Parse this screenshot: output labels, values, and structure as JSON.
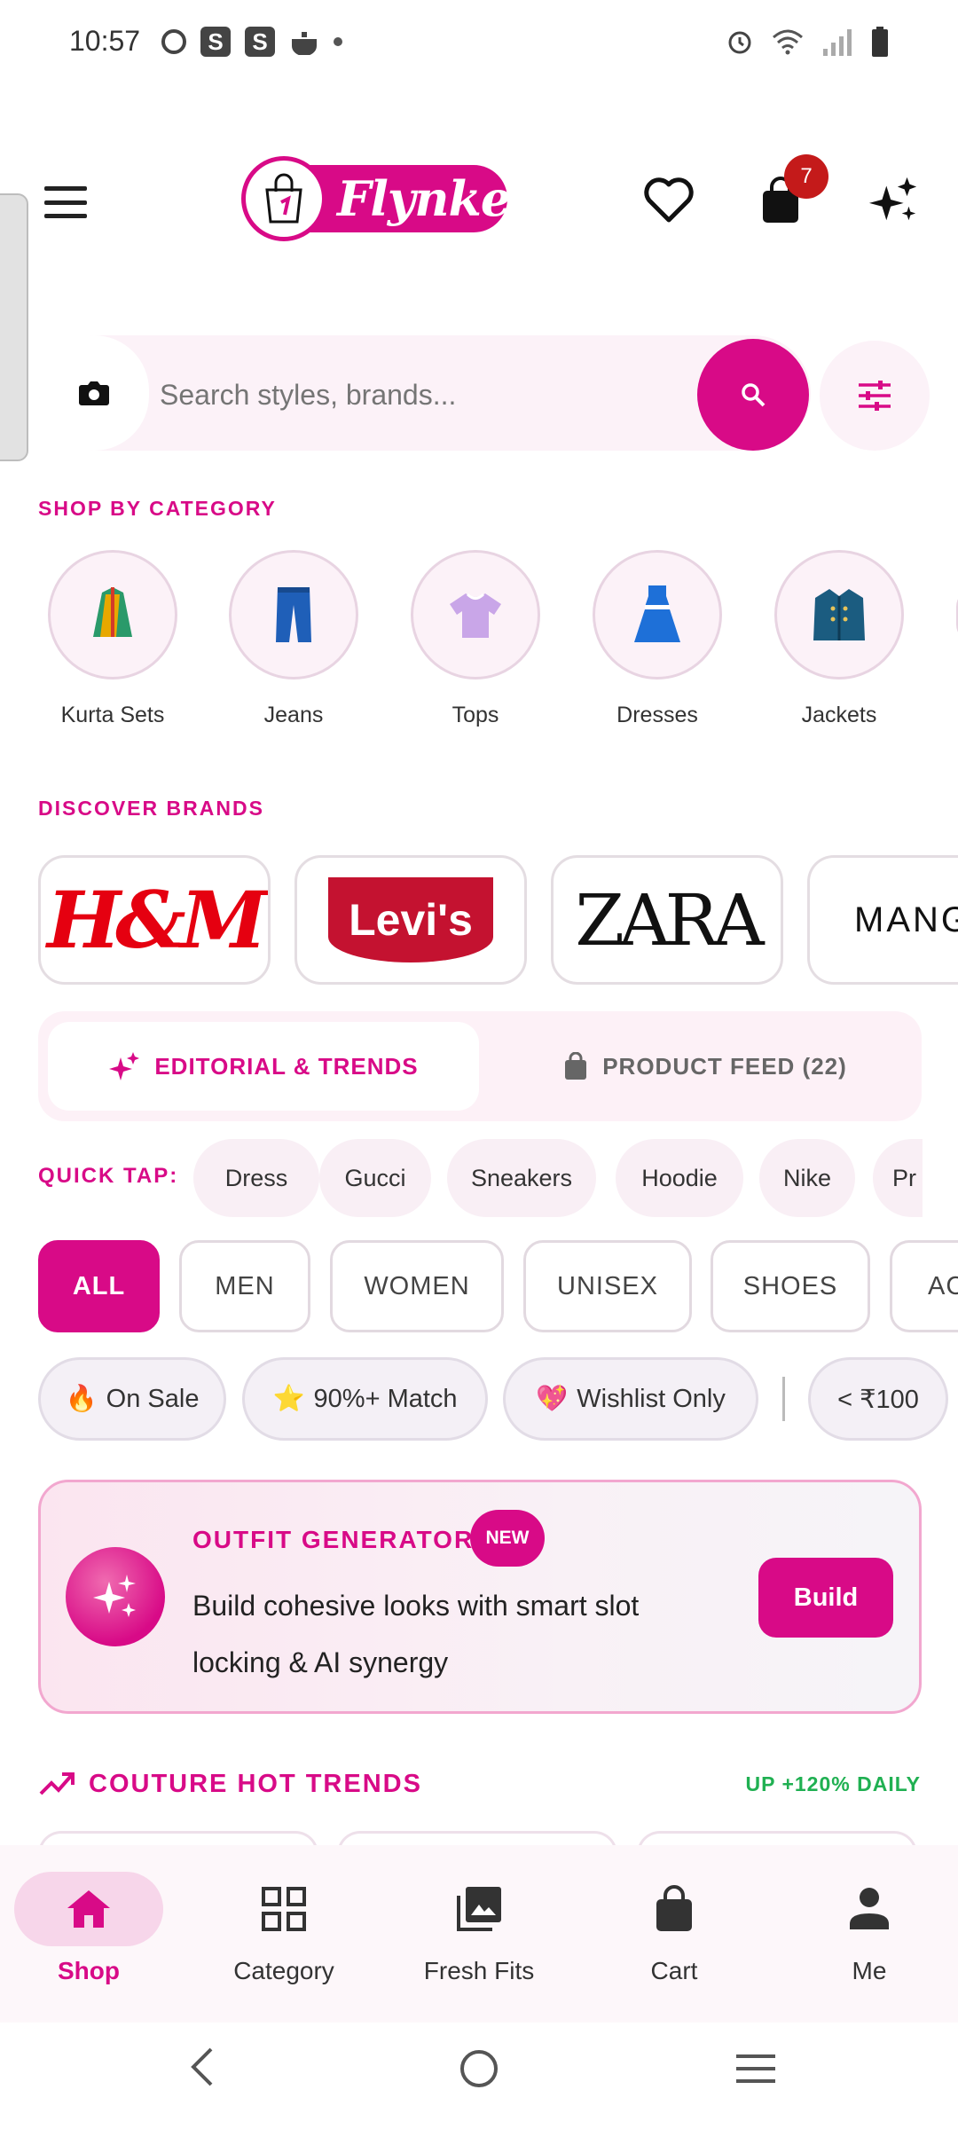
{
  "status_bar": {
    "time": "10:57"
  },
  "header": {
    "logo_text": "Flynker",
    "cart_count": "7"
  },
  "search": {
    "placeholder": "Search styles, brands..."
  },
  "categories": {
    "title": "SHOP BY CATEGORY",
    "items": [
      {
        "label": "Kurta Sets",
        "icon": "kurta-icon"
      },
      {
        "label": "Jeans",
        "icon": "jeans-icon"
      },
      {
        "label": "Tops",
        "icon": "top-icon"
      },
      {
        "label": "Dresses",
        "icon": "dress-icon"
      },
      {
        "label": "Jackets",
        "icon": "jacket-icon"
      }
    ]
  },
  "brands": {
    "title": "DISCOVER BRANDS",
    "items": [
      "H&M",
      "Levi's",
      "ZARA",
      "MANGO"
    ]
  },
  "segments": {
    "editorial": "EDITORIAL & TRENDS",
    "feed": "PRODUCT FEED (22)"
  },
  "quick_tap": {
    "label": "QUICK TAP:",
    "chips": [
      "Dress",
      "Gucci",
      "Sneakers",
      "Hoodie",
      "Nike",
      "Pr"
    ]
  },
  "gender_tabs": [
    "ALL",
    "MEN",
    "WOMEN",
    "UNISEX",
    "SHOES",
    "AC"
  ],
  "filters": [
    {
      "emoji": "🔥",
      "label": "On Sale"
    },
    {
      "emoji": "⭐",
      "label": "90%+ Match"
    },
    {
      "emoji": "💖",
      "label": "Wishlist Only"
    },
    {
      "emoji": "",
      "label": "< ₹100"
    }
  ],
  "outfit_generator": {
    "title": "OUTFIT GENERATOR",
    "badge": "NEW",
    "description": "Build cohesive looks with smart slot locking & AI synergy",
    "button": "Build"
  },
  "trends": {
    "title": "COUTURE HOT TRENDS",
    "tag": "UP +120% DAILY"
  },
  "bottom_nav": [
    {
      "label": "Shop",
      "icon": "home-icon",
      "active": true
    },
    {
      "label": "Category",
      "icon": "grid-icon",
      "active": false
    },
    {
      "label": "Fresh Fits",
      "icon": "gallery-icon",
      "active": false
    },
    {
      "label": "Cart",
      "icon": "bag-icon",
      "active": false
    },
    {
      "label": "Me",
      "icon": "person-icon",
      "active": false
    }
  ],
  "colors": {
    "accent": "#d80a87",
    "badge_red": "#c41a1a",
    "trend_green": "#20b052"
  }
}
